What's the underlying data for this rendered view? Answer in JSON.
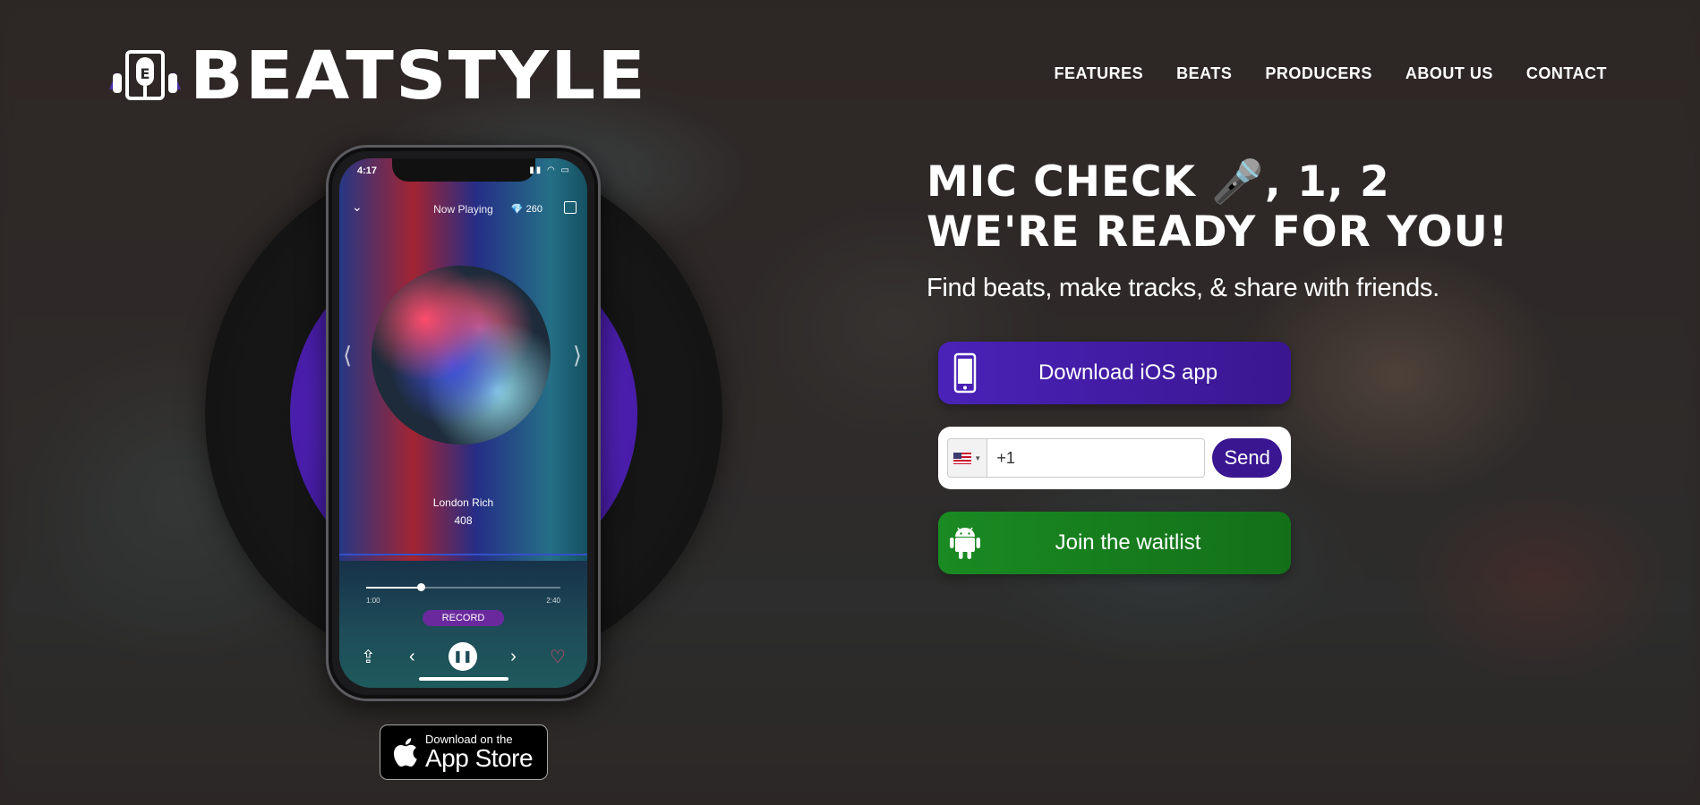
{
  "brand": {
    "name": "BEATSTYLE",
    "logo_letter": "E"
  },
  "nav": {
    "items": [
      {
        "label": "FEATURES"
      },
      {
        "label": "BEATS"
      },
      {
        "label": "PRODUCERS"
      },
      {
        "label": "ABOUT US"
      },
      {
        "label": "CONTACT"
      }
    ]
  },
  "hero": {
    "headline_line1_pre": "MIC CHECK",
    "headline_emoji": "🎤",
    "headline_line1_post": ", 1, 2",
    "headline_line2": "WE'RE READY FOR YOU!",
    "subhead": "Find beats, make tracks, & share with friends."
  },
  "cta": {
    "ios_label": "Download iOS app",
    "phone_value": "+1",
    "send_label": "Send",
    "android_label": "Join the waitlist"
  },
  "phone_screen": {
    "time": "4:17",
    "status_icons": "▮▮ ◠ ▭",
    "title": "Now Playing",
    "gem_icon": "💎",
    "gems": "260",
    "track_name": "London Rich",
    "track_count": "408",
    "time_start": "1:00",
    "time_end": "2:40",
    "progress": 0.28,
    "record_label": "RECORD"
  },
  "appstore": {
    "small": "Download on the",
    "big": "App Store"
  },
  "colors": {
    "ios_button": "#4a22b8",
    "android_button": "#1a8a22",
    "send_button": "#3a1690",
    "record_label": "#5a2ac8"
  }
}
